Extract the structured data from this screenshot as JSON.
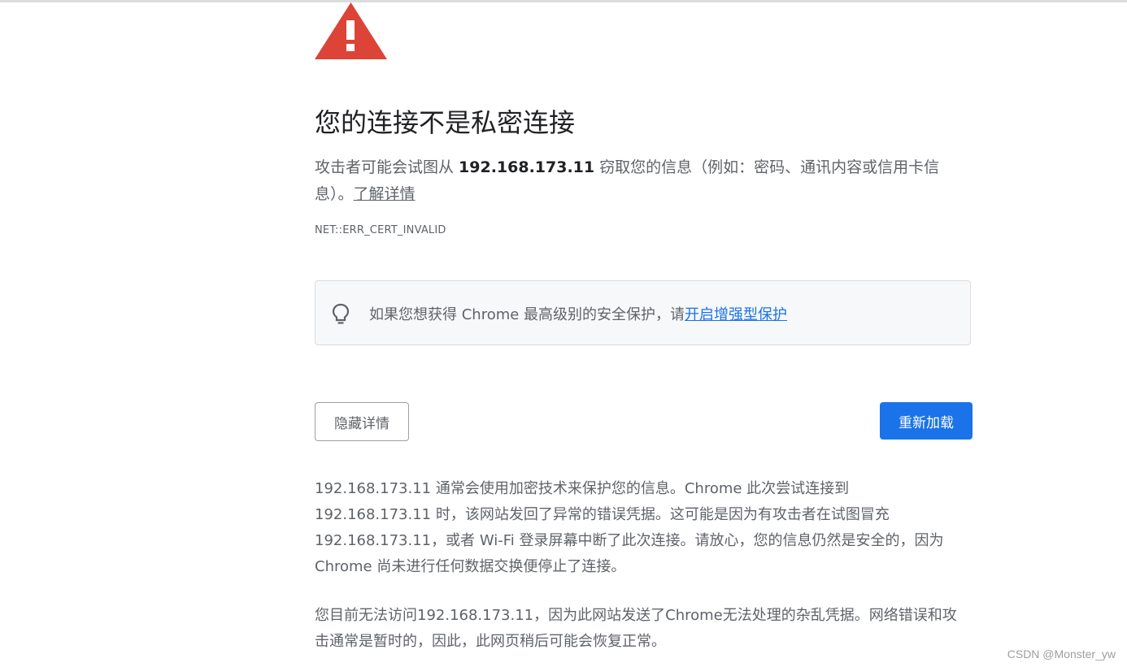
{
  "heading": "您的连接不是私密连接",
  "description": {
    "before": "攻击者可能会试图从 ",
    "host": "192.168.173.11",
    "after": " 窃取您的信息（例如：密码、通讯内容或信用卡信息）。",
    "learn_more": "了解详情"
  },
  "error_code": "NET::ERR_CERT_INVALID",
  "tip": {
    "icon": "lightbulb-icon",
    "text": "如果您想获得 Chrome 最高级别的安全保护，请",
    "link": "开启增强型保护"
  },
  "buttons": {
    "hide_details": "隐藏详情",
    "reload": "重新加载"
  },
  "details": {
    "paragraph1": "192.168.173.11 通常会使用加密技术来保护您的信息。Chrome 此次尝试连接到 192.168.173.11 时，该网站发回了异常的错误凭据。这可能是因为有攻击者在试图冒充 192.168.173.11，或者 Wi-Fi 登录屏幕中断了此次连接。请放心，您的信息仍然是安全的，因为 Chrome 尚未进行任何数据交换便停止了连接。",
    "paragraph2": "您目前无法访问192.168.173.11，因为此网站发送了Chrome无法处理的杂乱凭据。网络错误和攻击通常是暂时的，因此，此网页稍后可能会恢复正常。"
  },
  "watermark": "CSDN @Monster_yw",
  "colors": {
    "warning_red": "#db4437",
    "link_blue": "#1a73e8",
    "reload_button": "#1a73e8",
    "text_gray": "#5f6368"
  }
}
